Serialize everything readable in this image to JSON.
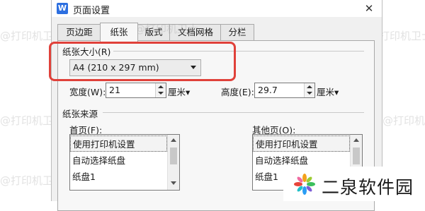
{
  "window": {
    "app_icon_letter": "W",
    "title": "页面设置",
    "close_symbol": "✕"
  },
  "tabs": [
    {
      "label": "页边距",
      "active": false
    },
    {
      "label": "纸张",
      "active": true
    },
    {
      "label": "版式",
      "active": false
    },
    {
      "label": "文档网格",
      "active": false
    },
    {
      "label": "分栏",
      "active": false
    }
  ],
  "paper_size": {
    "group_label": "纸张大小(R)",
    "selected": "A4 (210 x 297 mm)"
  },
  "width": {
    "label": "宽度(W):",
    "value": "21",
    "unit": "厘米▾"
  },
  "height": {
    "label": "高度(E):",
    "value": "29.7",
    "unit": "厘米▾"
  },
  "paper_source": {
    "group_label": "纸张来源",
    "first_page": {
      "label": "首页(F):",
      "items": [
        "使用打印机设置",
        "自动选择纸盘",
        "纸盘1"
      ],
      "selected_index": 0
    },
    "other_pages": {
      "label": "其他页(O):",
      "items": [
        "使用打印机设置",
        "自动选择纸盘",
        "纸盘1"
      ],
      "selected_index": 0
    }
  },
  "watermarks": [
    "@打印机卫士",
    "@打印机卫士",
    "@打印机卫士",
    "@打印机卫士",
    "@打印机卫士",
    "@打印机卫士"
  ],
  "brand": {
    "name": "二泉软件园"
  },
  "colors": {
    "highlight": "#e0413a",
    "app_icon": "#2d6fe0"
  }
}
